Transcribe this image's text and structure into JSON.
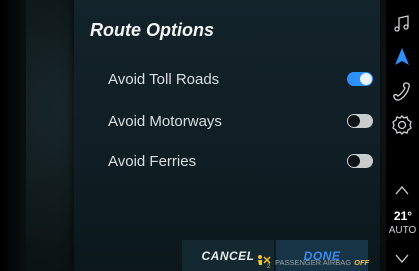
{
  "title": "Route Options",
  "options": [
    {
      "label": "Avoid Toll Roads",
      "enabled": true
    },
    {
      "label": "Avoid Motorways",
      "enabled": false
    },
    {
      "label": "Avoid Ferries",
      "enabled": false
    }
  ],
  "buttons": {
    "cancel": "CANCEL",
    "done": "DONE"
  },
  "status": {
    "airbag_text": "PASSENGER AIRBAG",
    "airbag_state": "OFF"
  },
  "climate": {
    "temperature": "21°",
    "mode": "AUTO"
  },
  "sidebar_icons": [
    "music-icon",
    "navigation-arrow-icon",
    "phone-icon",
    "settings-gear-icon",
    "chevron-up-icon",
    "chevron-down-icon"
  ],
  "colors": {
    "accent": "#2e8fff",
    "done": "#3a8df0",
    "airbag_off": "#f5c33a"
  }
}
